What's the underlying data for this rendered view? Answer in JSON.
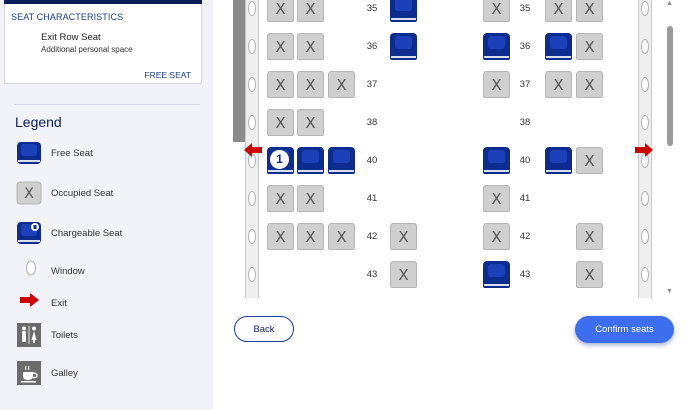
{
  "seat_characteristics": {
    "header": "SEAT CHARACTERISTICS",
    "title": "Exit Row Seat",
    "subtitle": "Additional personal space",
    "status": "FREE SEAT"
  },
  "legend": {
    "title": "Legend",
    "items": [
      {
        "icon": "free-seat-icon",
        "label": "Free Seat"
      },
      {
        "icon": "occupied-seat-icon",
        "label": "Occupied Seat"
      },
      {
        "icon": "chargeable-seat-icon",
        "label": "Chargeable Seat"
      },
      {
        "icon": "window-icon",
        "label": "Window"
      },
      {
        "icon": "exit-arrow-icon",
        "label": "Exit"
      },
      {
        "icon": "toilets-icon",
        "label": "Toilets"
      },
      {
        "icon": "galley-icon",
        "label": "Galley"
      }
    ]
  },
  "seat_map": {
    "rows": [
      {
        "number": "35",
        "seats": [
          "occupied",
          "occupied",
          null,
          "free",
          "occupied",
          "occupied",
          "occupied"
        ]
      },
      {
        "number": "36",
        "seats": [
          "occupied",
          "occupied",
          null,
          "free",
          "free",
          "free",
          "occupied"
        ]
      },
      {
        "number": "37",
        "seats": [
          "occupied",
          "occupied",
          "occupied",
          null,
          "occupied",
          "occupied",
          "occupied"
        ]
      },
      {
        "number": "38",
        "seats": [
          "occupied",
          "occupied",
          null,
          null,
          null,
          null,
          null
        ]
      },
      {
        "number": "40",
        "seats": [
          "selected",
          "free",
          "free",
          null,
          "free",
          "free",
          "occupied"
        ]
      },
      {
        "number": "41",
        "seats": [
          "occupied",
          "occupied",
          null,
          null,
          "occupied",
          null,
          null
        ]
      },
      {
        "number": "42",
        "seats": [
          "occupied",
          "occupied",
          "occupied",
          "occupied",
          "occupied",
          null,
          "occupied"
        ]
      },
      {
        "number": "43",
        "seats": [
          null,
          null,
          null,
          "occupied",
          "free",
          null,
          "occupied"
        ]
      }
    ],
    "selected_badge": "1",
    "exit_row": "40"
  },
  "actions": {
    "back": "Back",
    "confirm": "Confirm seats"
  },
  "colors": {
    "free_seat": "#0d2c8f",
    "occupied_seat": "#cfcfcf",
    "exit_arrow": "#cc0000",
    "confirm_button": "#3d6ef0"
  }
}
